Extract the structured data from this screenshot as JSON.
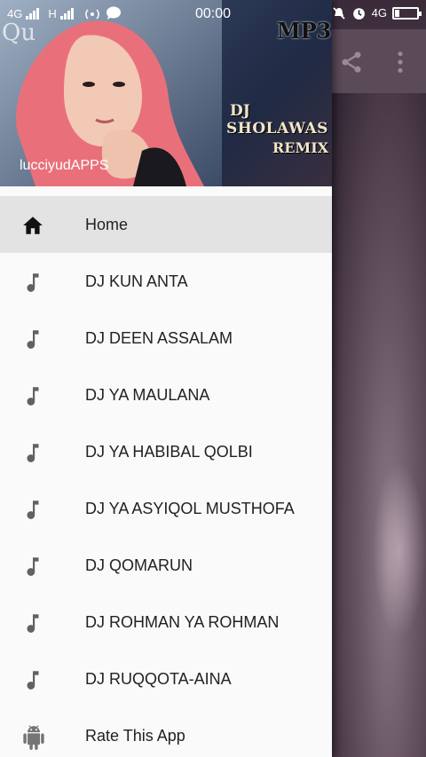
{
  "status_bar": {
    "network_left": "4G",
    "network_mid": "H",
    "time": "00:00",
    "network_right": "4G"
  },
  "drawer": {
    "header": {
      "app_name": "lucciyudAPPS",
      "banner_dj": "DJ",
      "banner_sholawat": "SHOLAWAS",
      "banner_remix": "REMIX",
      "banner_mp3": "MP3",
      "banner_quotes": "Qu"
    },
    "items": [
      {
        "label": "Home",
        "icon": "home-icon",
        "selected": true
      },
      {
        "label": "DJ KUN ANTA",
        "icon": "music-note-icon"
      },
      {
        "label": "DJ DEEN ASSALAM",
        "icon": "music-note-icon"
      },
      {
        "label": "DJ YA MAULANA",
        "icon": "music-note-icon"
      },
      {
        "label": "DJ YA HABIBAL QOLBI",
        "icon": "music-note-icon"
      },
      {
        "label": "DJ YA ASYIQOL MUSTHOFA",
        "icon": "music-note-icon"
      },
      {
        "label": "DJ QOMARUN",
        "icon": "music-note-icon"
      },
      {
        "label": "DJ ROHMAN YA ROHMAN",
        "icon": "music-note-icon"
      },
      {
        "label": "DJ RUQQOTA-AINA",
        "icon": "music-note-icon"
      },
      {
        "label": "Rate This App",
        "icon": "android-icon"
      }
    ]
  },
  "background_toolbar": {
    "actions": [
      "share-icon",
      "more-vert-icon"
    ]
  },
  "colors": {
    "drawer_bg": "#fafafa",
    "selected_bg": "#e3e3e3",
    "icon_gray": "#616161",
    "android_gray": "#757575"
  }
}
